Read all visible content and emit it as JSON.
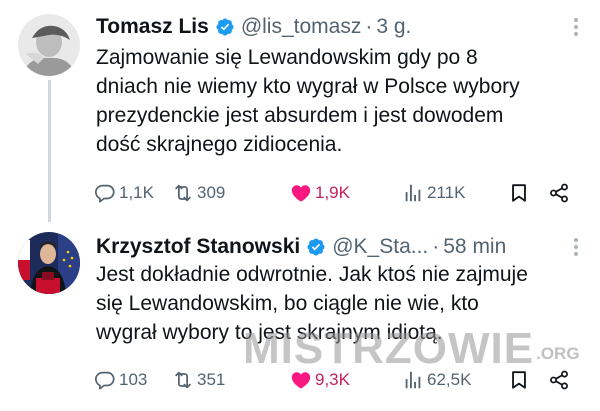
{
  "tweets": [
    {
      "author": "Tomasz Lis",
      "handle": "@lis_tomasz",
      "time": "3 g.",
      "text_lines": [
        "Zajmowanie się Lewandowskim gdy po 8",
        "dniach nie wiemy kto wygrał w Polsce wybory",
        "prezydenckie jest absurdem i jest  dowodem",
        "dość skrajnego zidiocenia."
      ],
      "replies": "1,1K",
      "retweets": "309",
      "likes": "1,9K",
      "views": "211K"
    },
    {
      "author": "Krzysztof Stanowski",
      "handle": "@K_Sta...",
      "time": "58 min",
      "text_lines": [
        "Jest dokładnie odwrotnie. Jak ktoś nie zajmuje",
        "się Lewandowskim, bo ciągle nie wie, kto",
        "wygrał wybory to jest skrajnym idiotą."
      ],
      "replies": "103",
      "retweets": "351",
      "likes": "9,3K",
      "views": "62,5K"
    }
  ],
  "separator": "·",
  "watermark": {
    "main": "MISTRZOWIE",
    "tld": ".ORG"
  },
  "icons": {
    "verified": "verified-badge-icon",
    "reply": "reply-icon",
    "retweet": "retweet-icon",
    "like": "heart-icon",
    "views": "views-chart-icon",
    "bookmark": "bookmark-icon",
    "share": "share-icon",
    "more": "more-icon"
  },
  "colors": {
    "verified": "#1d9bf0",
    "like_active": "#f91880",
    "secondary_text": "#536471",
    "primary_text": "#0f1419"
  }
}
